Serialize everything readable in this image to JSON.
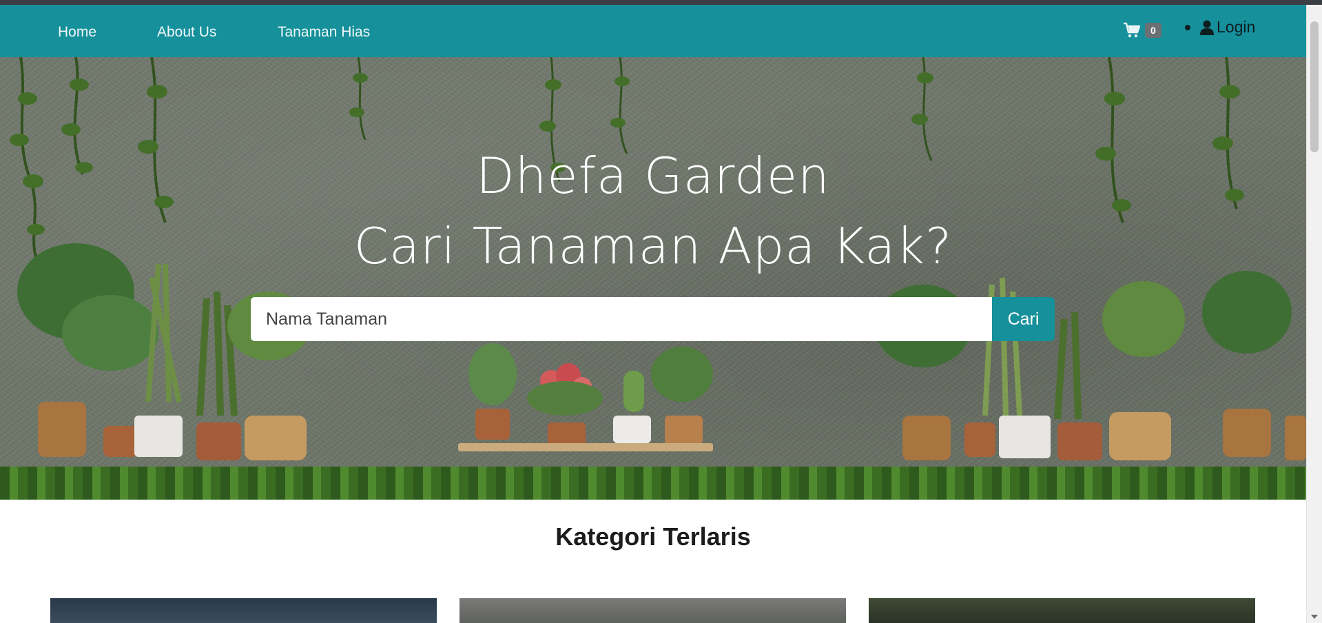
{
  "nav": {
    "links": [
      "Home",
      "About Us",
      "Tanaman Hias"
    ],
    "cart_icon": "shopping-cart-icon",
    "cart_count": "0",
    "user_icon": "user-icon",
    "login_label": "Login"
  },
  "hero": {
    "title_line1": "Dhefa Garden",
    "title_line2": "Cari Tanaman Apa Kak?",
    "search_placeholder": "Nama Tanaman",
    "search_button": "Cari"
  },
  "section": {
    "title": "Kategori Terlaris"
  },
  "colors": {
    "brand": "#16909b",
    "hero_wall": "#6e7569",
    "badge": "#6b7074"
  }
}
